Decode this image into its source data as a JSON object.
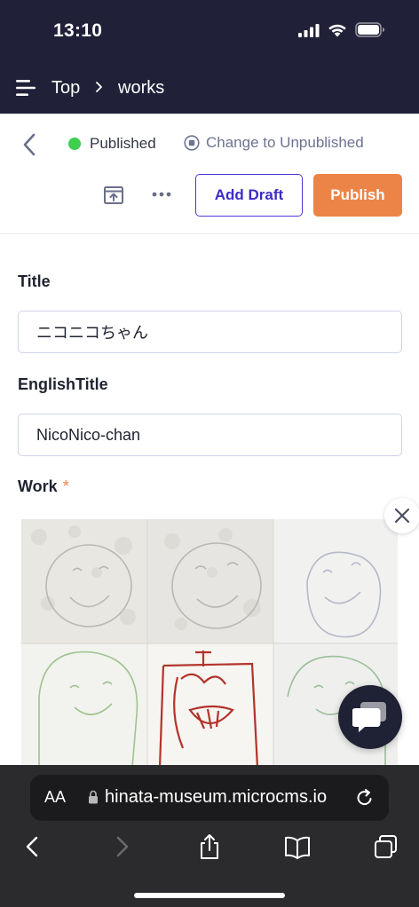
{
  "status_bar": {
    "time": "13:10",
    "icons": [
      "signal-icon",
      "wifi-icon",
      "battery-icon"
    ]
  },
  "header": {
    "menu_icon": "menu-icon",
    "breadcrumb": [
      "Top",
      "works"
    ]
  },
  "actions": {
    "status_label": "Published",
    "status_color": "#3ecf4d",
    "change_status_label": "Change to Unpublished",
    "add_draft_label": "Add Draft",
    "publish_label": "Publish",
    "accent_color": "#4836d6",
    "publish_color": "#ec8447"
  },
  "form": {
    "title_label": "Title",
    "title_value": "ニコニコちゃん",
    "english_title_label": "EnglishTitle",
    "english_title_value": "NicoNico-chan",
    "work_label": "Work",
    "work_required_mark": "*"
  },
  "browser": {
    "text_size_label": "AA",
    "url": "hinata-museum.microcms.io",
    "toolbar_icons": [
      "back-icon",
      "forward-icon",
      "share-icon",
      "bookmarks-icon",
      "tabs-icon"
    ]
  }
}
